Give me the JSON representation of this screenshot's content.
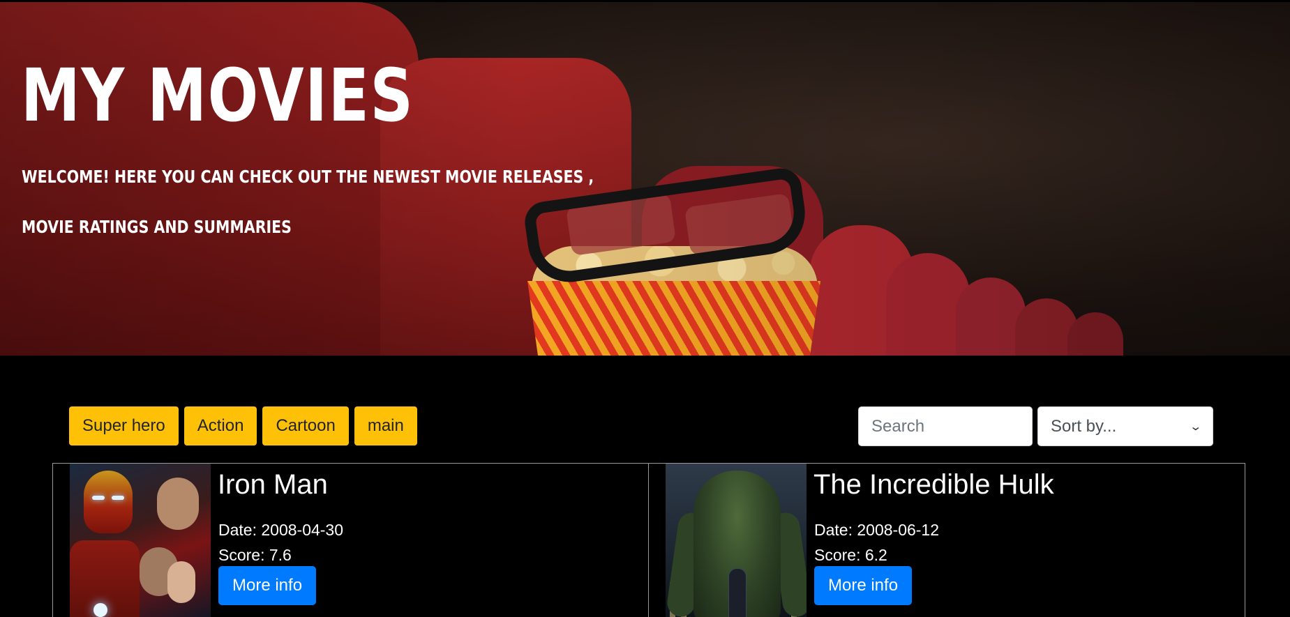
{
  "hero": {
    "title": "MY MOVIES",
    "subtitle_line1": "WELCOME! HERE YOU CAN CHECK OUT THE NEWEST MOVIE RELEASES ,",
    "subtitle_line2": "MOVIE RATINGS AND SUMMARIES"
  },
  "filters": [
    {
      "label": "Super hero"
    },
    {
      "label": "Action"
    },
    {
      "label": "Cartoon"
    },
    {
      "label": "main"
    }
  ],
  "search": {
    "placeholder": "Search",
    "value": ""
  },
  "sort": {
    "selected": "Sort by..."
  },
  "colors": {
    "filter_button": "#ffc107",
    "primary_button": "#007bff",
    "page_background": "#000000"
  },
  "movies": [
    {
      "title": "Iron Man",
      "date": "Date: 2008-04-30",
      "score": "Score: 7.6",
      "button_label": "More info"
    },
    {
      "title": "The Incredible Hulk",
      "date": "Date: 2008-06-12",
      "score": "Score: 6.2",
      "button_label": "More info"
    }
  ]
}
